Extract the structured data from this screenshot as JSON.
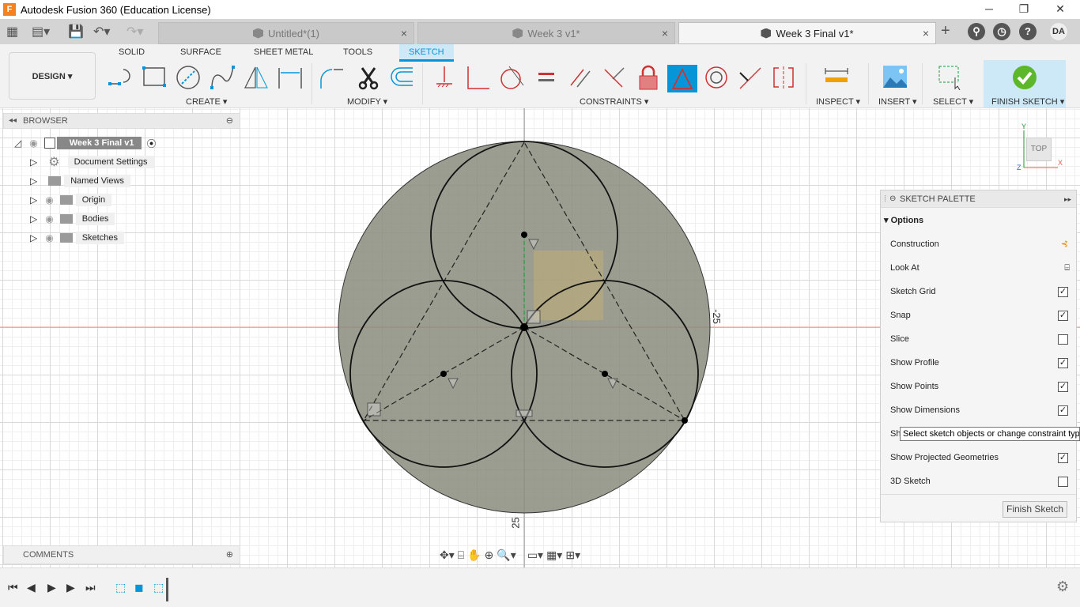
{
  "app": {
    "title": "Autodesk Fusion 360 (Education License)",
    "logo": "F"
  },
  "window": {
    "minimize": "─",
    "maximize": "❐",
    "close": "✕"
  },
  "doc_tabs": [
    {
      "label": "Untitled*(1)",
      "active": false
    },
    {
      "label": "Week 3 v1*",
      "active": false
    },
    {
      "label": "Week 3 Final v1*",
      "active": true
    }
  ],
  "tab_close": "×",
  "user_initials": "DA",
  "ribbon": {
    "tabs": [
      "SOLID",
      "SURFACE",
      "SHEET METAL",
      "TOOLS",
      "SKETCH"
    ],
    "active_tab": "SKETCH",
    "workspace": "DESIGN ▾",
    "groups": {
      "create": "CREATE ▾",
      "modify": "MODIFY ▾",
      "constraints": "CONSTRAINTS ▾",
      "inspect": "INSPECT ▾",
      "insert": "INSERT ▾",
      "select": "SELECT ▾",
      "finish": "FINISH SKETCH ▾"
    },
    "accent": "#0696d7"
  },
  "browser": {
    "title": "BROWSER",
    "root": "Week 3 Final v1",
    "items": [
      {
        "label": "Document Settings",
        "icon": "gear-icon"
      },
      {
        "label": "Named Views",
        "icon": "folder-icon"
      },
      {
        "label": "Origin",
        "icon": "folder-icon"
      },
      {
        "label": "Bodies",
        "icon": "folder-icon"
      },
      {
        "label": "Sketches",
        "icon": "folder-icon"
      }
    ]
  },
  "comments": {
    "title": "COMMENTS"
  },
  "canvas": {
    "dim_right": "-25",
    "dim_bottom": "25",
    "viewcube": "TOP",
    "axis_x": "X",
    "axis_y": "Y",
    "axis_z": "Z"
  },
  "palette": {
    "title": "SKETCH PALETTE",
    "section": "Options",
    "rows": [
      {
        "label": "Construction",
        "type": "icon"
      },
      {
        "label": "Look At",
        "type": "icon"
      },
      {
        "label": "Sketch Grid",
        "checked": true
      },
      {
        "label": "Snap",
        "checked": true
      },
      {
        "label": "Slice",
        "checked": false
      },
      {
        "label": "Show Profile",
        "checked": true
      },
      {
        "label": "Show Points",
        "checked": true
      },
      {
        "label": "Show Dimensions",
        "checked": true
      },
      {
        "label": "Sh",
        "checked": true
      },
      {
        "label": "Show Projected Geometries",
        "checked": true
      },
      {
        "label": "3D Sketch",
        "checked": false
      }
    ],
    "finish_button": "Finish Sketch",
    "tooltip": "Select sketch objects or change constraint type"
  }
}
